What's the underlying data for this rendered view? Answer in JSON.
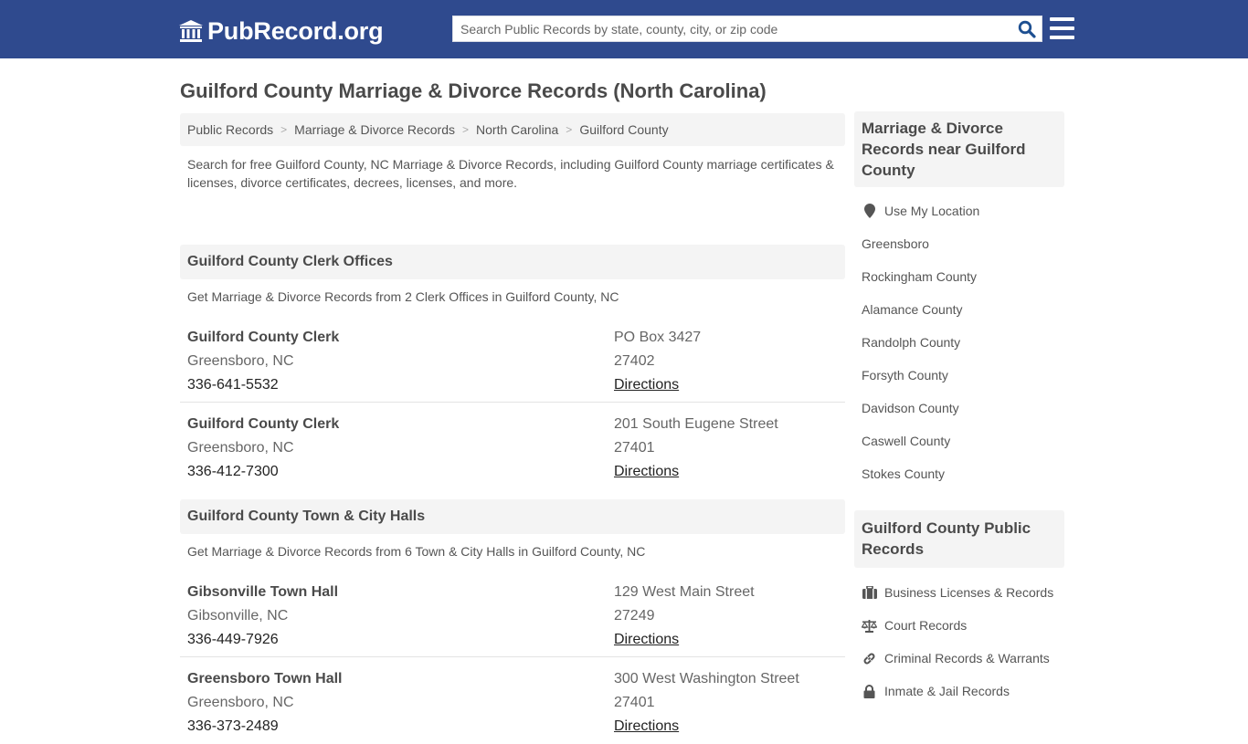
{
  "header": {
    "logo_text": "PubRecord.org",
    "search_placeholder": "Search Public Records by state, county, city, or zip code",
    "search_value": "",
    "brand_color": "#2f4a8e"
  },
  "page": {
    "title": "Guilford County Marriage & Divorce Records (North Carolina)",
    "breadcrumb": [
      "Public Records",
      "Marriage & Divorce Records",
      "North Carolina",
      "Guilford County"
    ],
    "breadcrumb_separator": ">",
    "intro": "Search for free Guilford County, NC Marriage & Divorce Records, including Guilford County marriage certificates & licenses, divorce certificates, decrees, licenses, and more."
  },
  "sections": [
    {
      "heading": "Guilford County Clerk Offices",
      "description": "Get Marriage & Divorce Records from 2 Clerk Offices in Guilford County, NC",
      "records": [
        {
          "name": "Guilford County Clerk",
          "city": "Greensboro, NC",
          "phone": "336-641-5532",
          "address": "PO Box 3427",
          "zip": "27402",
          "directions": "Directions"
        },
        {
          "name": "Guilford County Clerk",
          "city": "Greensboro, NC",
          "phone": "336-412-7300",
          "address": "201 South Eugene Street",
          "zip": "27401",
          "directions": "Directions"
        }
      ]
    },
    {
      "heading": "Guilford County Town & City Halls",
      "description": "Get Marriage & Divorce Records from 6 Town & City Halls in Guilford County, NC",
      "records": [
        {
          "name": "Gibsonville Town Hall",
          "city": "Gibsonville, NC",
          "phone": "336-449-7926",
          "address": "129 West Main Street",
          "zip": "27249",
          "directions": "Directions"
        },
        {
          "name": "Greensboro Town Hall",
          "city": "Greensboro, NC",
          "phone": "336-373-2489",
          "address": "300 West Washington Street",
          "zip": "27401",
          "directions": "Directions"
        }
      ]
    }
  ],
  "sidebar": {
    "nearby": {
      "heading": "Marriage & Divorce Records near Guilford County",
      "location_label": "Use My Location",
      "location_icon": "map-marker-icon",
      "items": [
        "Greensboro",
        "Rockingham County",
        "Alamance County",
        "Randolph County",
        "Forsyth County",
        "Davidson County",
        "Caswell County",
        "Stokes County"
      ]
    },
    "public_records": {
      "heading": "Guilford County Public Records",
      "items": [
        {
          "label": "Business Licenses & Records",
          "icon": "briefcase-icon"
        },
        {
          "label": "Court Records",
          "icon": "balance-scale-icon"
        },
        {
          "label": "Criminal Records & Warrants",
          "icon": "link-icon"
        },
        {
          "label": "Inmate & Jail Records",
          "icon": "lock-icon"
        }
      ]
    }
  }
}
